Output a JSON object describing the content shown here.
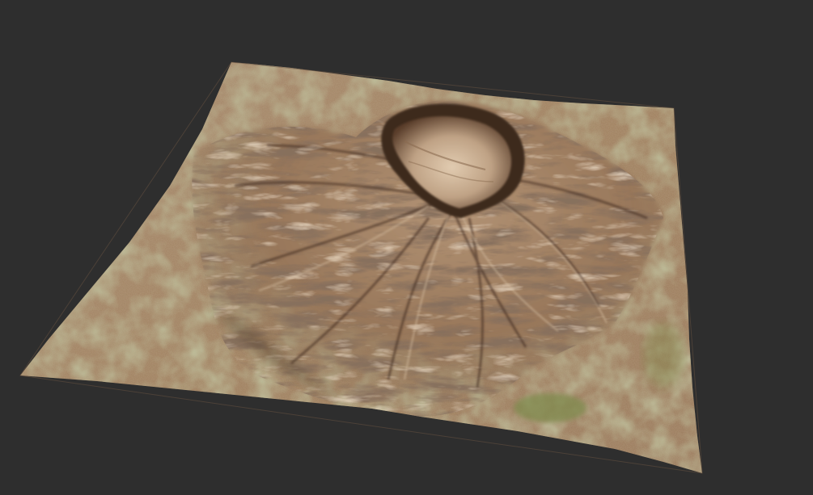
{
  "viewport": {
    "background_color": "#2e2e2e"
  },
  "terrain": {
    "subject": "3d-terrain-heightmap-render",
    "feature": "volcanic-crater-mountain",
    "colors": {
      "base_soil": "#9c7b5e",
      "dry_grass": "#8d8a5c",
      "green_patch": "#7f8a4e",
      "ridge_light": "#c9ab8c",
      "ridge_shadow": "#3e2a1e",
      "crater_floor": "#d8c0a3",
      "plain_light": "#b19272"
    }
  }
}
